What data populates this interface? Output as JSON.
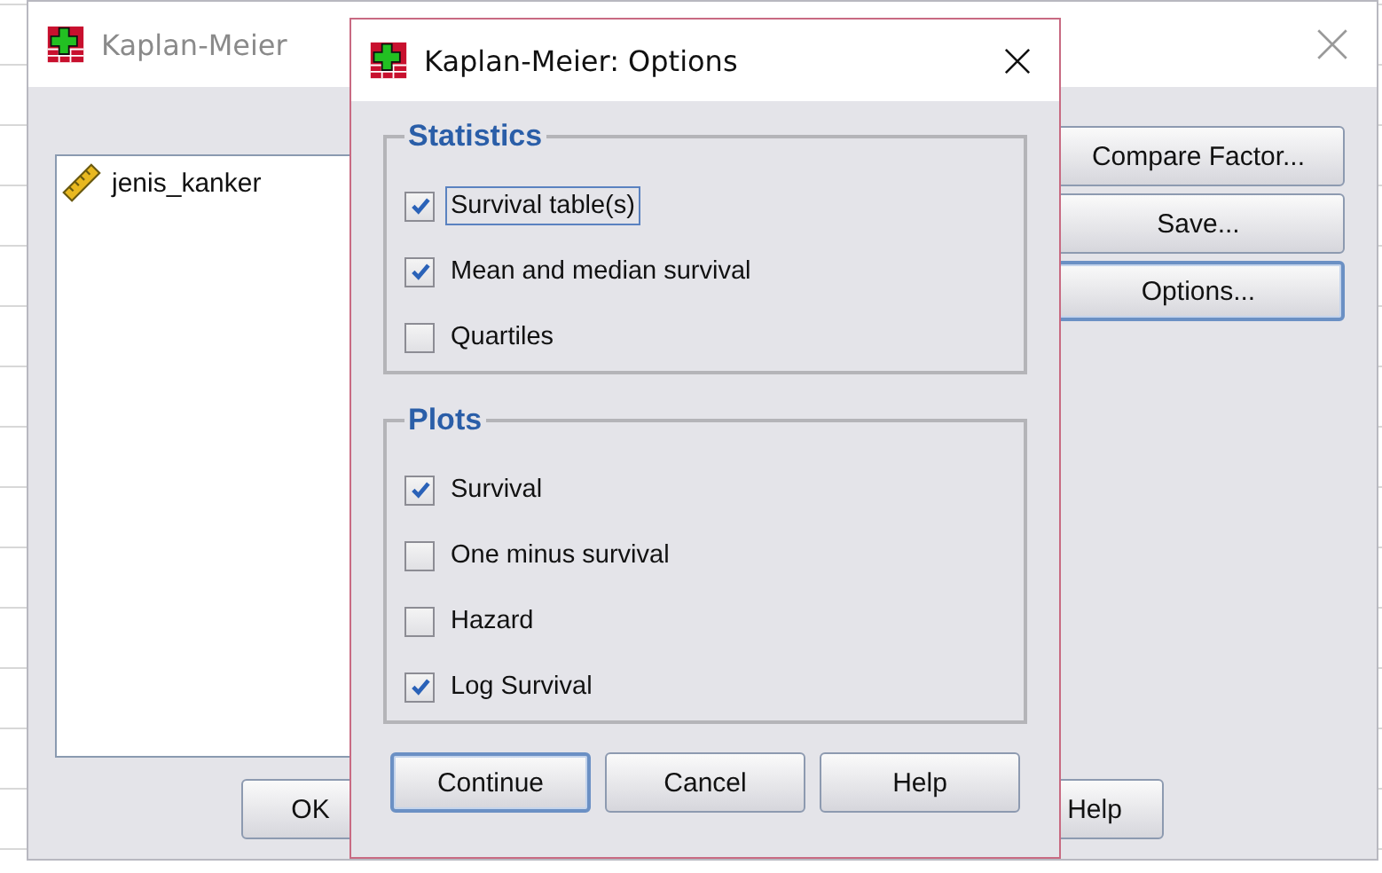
{
  "main_dialog": {
    "title": "Kaplan-Meier",
    "variables": [
      {
        "name": "jenis_kanker"
      }
    ],
    "side_buttons": [
      {
        "label": "Compare Factor...",
        "focused": false
      },
      {
        "label": "Save...",
        "focused": false
      },
      {
        "label": "Options...",
        "focused": true
      }
    ],
    "bottom_buttons": [
      "OK",
      "Help"
    ]
  },
  "options_dialog": {
    "title": "Kaplan-Meier: Options",
    "groups": [
      {
        "title": "Statistics",
        "items": [
          {
            "label": "Survival table(s)",
            "checked": true,
            "focused": true
          },
          {
            "label": "Mean and median survival",
            "checked": true,
            "focused": false
          },
          {
            "label": "Quartiles",
            "checked": false,
            "focused": false
          }
        ]
      },
      {
        "title": "Plots",
        "items": [
          {
            "label": "Survival",
            "checked": true,
            "focused": false
          },
          {
            "label": "One minus survival",
            "checked": false,
            "focused": false
          },
          {
            "label": "Hazard",
            "checked": false,
            "focused": false
          },
          {
            "label": "Log Survival",
            "checked": true,
            "focused": false
          }
        ]
      }
    ],
    "buttons": [
      {
        "label": "Continue",
        "default": true
      },
      {
        "label": "Cancel",
        "default": false
      },
      {
        "label": "Help",
        "default": false
      }
    ]
  }
}
